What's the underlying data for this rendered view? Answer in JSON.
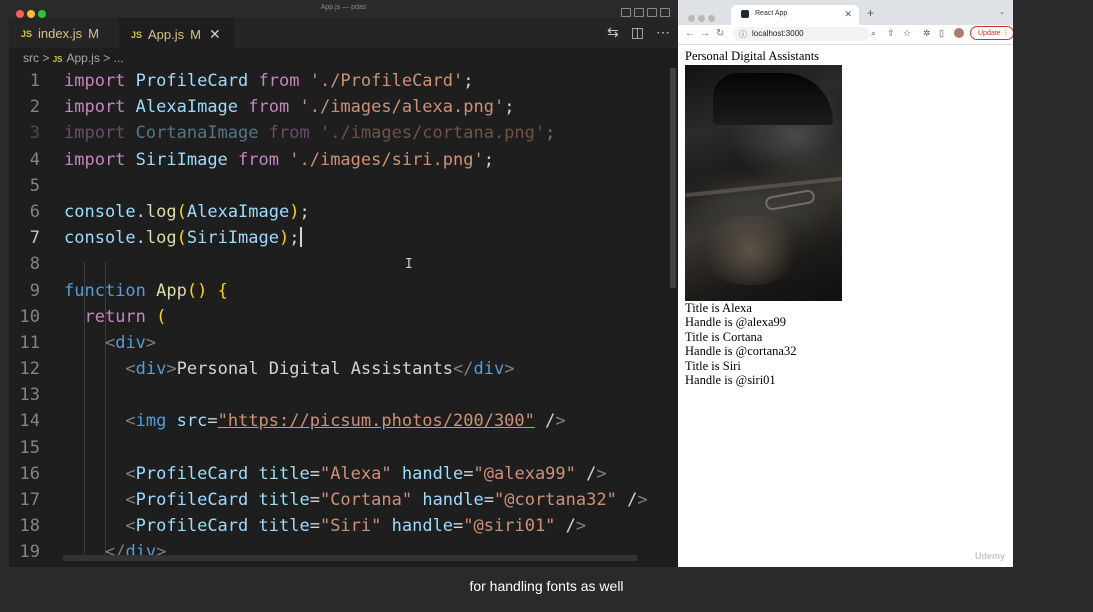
{
  "vscode": {
    "window_title": "App.js — pdas",
    "tabs": [
      {
        "icon": "JS",
        "name": "index.js",
        "status": "M"
      },
      {
        "icon": "JS",
        "name": "App.js",
        "status": "M",
        "close": "✕"
      }
    ],
    "breadcrumb": {
      "folder": "src",
      "sep1": ">",
      "icon": "JS",
      "file": "App.js",
      "sep2": "> ..."
    },
    "code_lines": [
      "import ProfileCard from './ProfileCard';",
      "import AlexaImage from './images/alexa.png';",
      "import CortanaImage from './images/cortana.png';",
      "import SiriImage from './images/siri.png';",
      "",
      "console.log(AlexaImage);",
      "console.log(SiriImage);",
      "",
      "function App() {",
      "  return (",
      "    <div>",
      "      <div>Personal Digital Assistants</div>",
      "",
      "      <img src=\"https://picsum.photos/200/300\" />",
      "",
      "      <ProfileCard title=\"Alexa\" handle=\"@alexa99\" />",
      "      <ProfileCard title=\"Cortana\" handle=\"@cortana32\" />",
      "      <ProfileCard title=\"Siri\" handle=\"@siri01\" />",
      "    </div>"
    ],
    "line_numbers": [
      "1",
      "2",
      "3",
      "4",
      "5",
      "6",
      "7",
      "8",
      "9",
      "10",
      "11",
      "12",
      "13",
      "14",
      "15",
      "16",
      "17",
      "18",
      "19"
    ],
    "current_line": 7
  },
  "browser": {
    "tab_title": "React App",
    "tab_close": "✕",
    "new_tab": "+",
    "url": "localhost:3000",
    "update_label": "Update",
    "page": {
      "heading": "Personal Digital Assistants",
      "lines": [
        "Title is Alexa",
        "Handle is @alexa99",
        "Title is Cortana",
        "Handle is @cortana32",
        "Title is Siri",
        "Handle is @siri01"
      ]
    },
    "watermark": "Udemy"
  },
  "caption": "for handling fonts as well",
  "colors": {
    "editor_bg": "#1e1e1e",
    "keyword": "#569cd6",
    "control_keyword": "#c586c0",
    "identifier": "#9cdcfe",
    "string": "#ce9178",
    "function": "#dcdcaa",
    "component": "#4ec9b0"
  }
}
